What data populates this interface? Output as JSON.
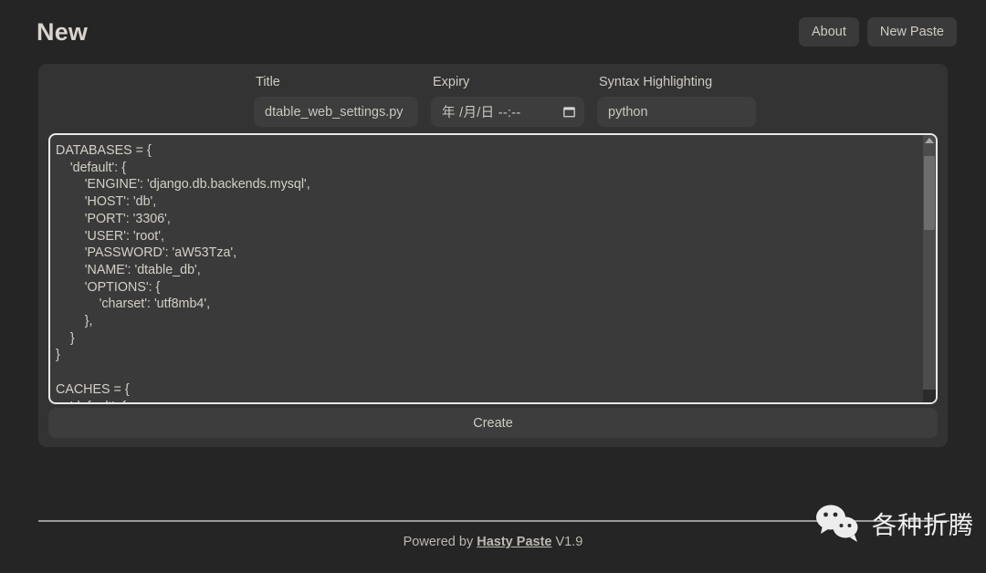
{
  "header": {
    "brand": "New",
    "nav": [
      {
        "label": "About",
        "name": "nav-about"
      },
      {
        "label": "New Paste",
        "name": "nav-new-paste"
      }
    ]
  },
  "form": {
    "title": {
      "label": "Title",
      "value": "dtable_web_settings.py",
      "placeholder": "Title"
    },
    "expiry": {
      "label": "Expiry",
      "value": "年 /月/日 --:--",
      "icon": "calendar-icon"
    },
    "syntax": {
      "label": "Syntax Highlighting",
      "value": "python",
      "placeholder": "Syntax Highlighting"
    }
  },
  "editor": {
    "content": "DATABASES = {\n    'default': {\n        'ENGINE': 'django.db.backends.mysql',\n        'HOST': 'db',\n        'PORT': '3306',\n        'USER': 'root',\n        'PASSWORD': 'aW53Tza',\n        'NAME': 'dtable_db',\n        'OPTIONS': {\n            'charset': 'utf8mb4',\n        },\n    }\n}\n\nCACHES = {\n    'default': {",
    "scrollbar": {
      "thumb_top_pct": 4,
      "thumb_height_pct": 30
    }
  },
  "actions": {
    "create_label": "Create"
  },
  "footer": {
    "prefix": "Powered by",
    "link": "Hasty Paste",
    "version": "V1.9"
  },
  "watermark": {
    "icon": "wechat-icon",
    "text": "各种折腾"
  },
  "colors": {
    "page_bg": "#252525",
    "card_bg": "#333333",
    "input_bg": "#3d3d3d",
    "editor_bg": "#3a3a3a",
    "focus_border": "#e8e8e8",
    "text": "#cfcbc4",
    "code_text": "#d4d0c8"
  }
}
